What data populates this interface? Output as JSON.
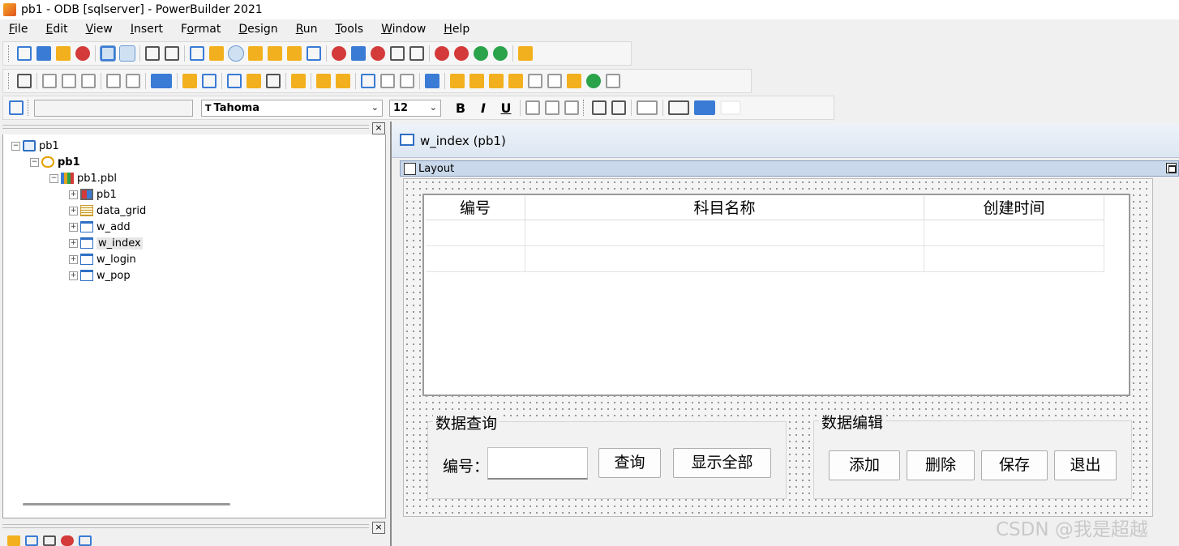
{
  "window": {
    "title": "pb1 - ODB [sqlserver]  - PowerBuilder 2021"
  },
  "menu": [
    {
      "label": "File",
      "u": "F",
      "rest": "ile"
    },
    {
      "label": "Edit",
      "u": "E",
      "rest": "dit"
    },
    {
      "label": "View",
      "u": "V",
      "rest": "iew"
    },
    {
      "label": "Insert",
      "u": "I",
      "rest": "nsert"
    },
    {
      "label": "Format",
      "u": "F",
      "rest": "o",
      "rest2": "rmat"
    },
    {
      "label": "Design",
      "u": "D",
      "rest": "esign"
    },
    {
      "label": "Run",
      "u": "R",
      "rest": "un"
    },
    {
      "label": "Tools",
      "u": "T",
      "rest": "ools"
    },
    {
      "label": "Window",
      "u": "W",
      "rest": "indow"
    },
    {
      "label": "Help",
      "u": "H",
      "rest": "elp"
    }
  ],
  "format_toolbar": {
    "font_name": "Tahoma",
    "font_size": "12",
    "bold": "B",
    "italic": "I",
    "underline": "U"
  },
  "tree": {
    "workspace": "pb1",
    "target": "pb1",
    "library": "pb1.pbl",
    "objects": [
      {
        "label": "pb1",
        "kind": "application"
      },
      {
        "label": "data_grid",
        "kind": "datawindow"
      },
      {
        "label": "w_add",
        "kind": "window"
      },
      {
        "label": "w_index",
        "kind": "window"
      },
      {
        "label": "w_login",
        "kind": "window"
      },
      {
        "label": "w_pop",
        "kind": "window"
      }
    ]
  },
  "painter": {
    "tab_title": "w_index (pb1)",
    "layout_title": "Layout"
  },
  "grid": {
    "columns": [
      "编号",
      "科目名称",
      "创建时间"
    ]
  },
  "query_group": {
    "title": "数据查询",
    "id_label": "编号：",
    "id_value": "",
    "query_button": "查询",
    "show_all_button": "显示全部"
  },
  "edit_group": {
    "title": "数据编辑",
    "add_button": "添加",
    "delete_button": "删除",
    "save_button": "保存",
    "exit_button": "退出"
  },
  "watermark": "CSDN @我是超越"
}
